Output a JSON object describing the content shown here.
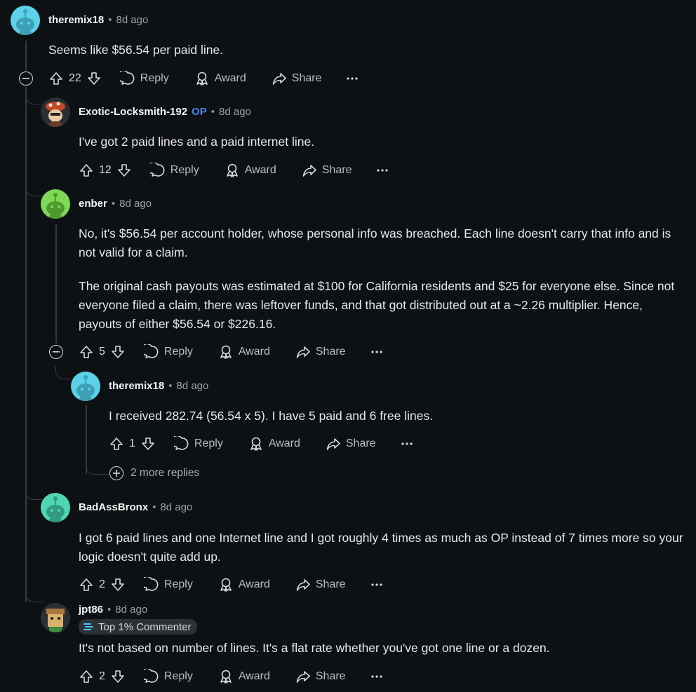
{
  "actions_labels": {
    "reply": "Reply",
    "award": "Award",
    "share": "Share"
  },
  "comments": [
    {
      "user": "theremix18",
      "time": "8d ago",
      "body": [
        "Seems like $56.54 per paid line."
      ],
      "votes": "22"
    },
    {
      "user": "Exotic-Locksmith-192",
      "op_tag": "OP",
      "time": "8d ago",
      "body": [
        "I've got 2 paid lines and a paid internet line."
      ],
      "votes": "12"
    },
    {
      "user": "enber",
      "time": "8d ago",
      "body": [
        "No, it's $56.54 per account holder, whose personal info was breached. Each line doesn't carry that info and is not valid for a claim.",
        "The original cash payouts was estimated at $100 for California residents and $25 for everyone else. Since not everyone filed a claim, there was leftover funds, and that got distributed out at a ~2.26 multiplier. Hence, payouts of either $56.54 or $226.16."
      ],
      "votes": "5"
    },
    {
      "user": "theremix18",
      "time": "8d ago",
      "body": [
        "I received 282.74 (56.54 x 5). I have 5 paid and 6 free lines."
      ],
      "votes": "1"
    },
    {
      "user": "BadAssBronx",
      "time": "8d ago",
      "body": [
        "I got 6 paid lines and one Internet line and I got roughly 4 times as much as OP instead of 7 times more so your logic doesn't quite add up."
      ],
      "votes": "2"
    },
    {
      "user": "jpt86",
      "time": "8d ago",
      "badge": "Top 1% Commenter",
      "body": [
        "It's not based on number of lines. It's a flat rate whether you've got one line or a dozen."
      ],
      "votes": "2"
    }
  ],
  "more_replies": "2 more replies",
  "dot": "•",
  "colors": {
    "background": "#0e1113",
    "op": "#4d7ff0",
    "snoo_cyan": "#5bd2e8",
    "snoo_green": "#7ed957",
    "snoo_teal": "#4fd6b4"
  }
}
